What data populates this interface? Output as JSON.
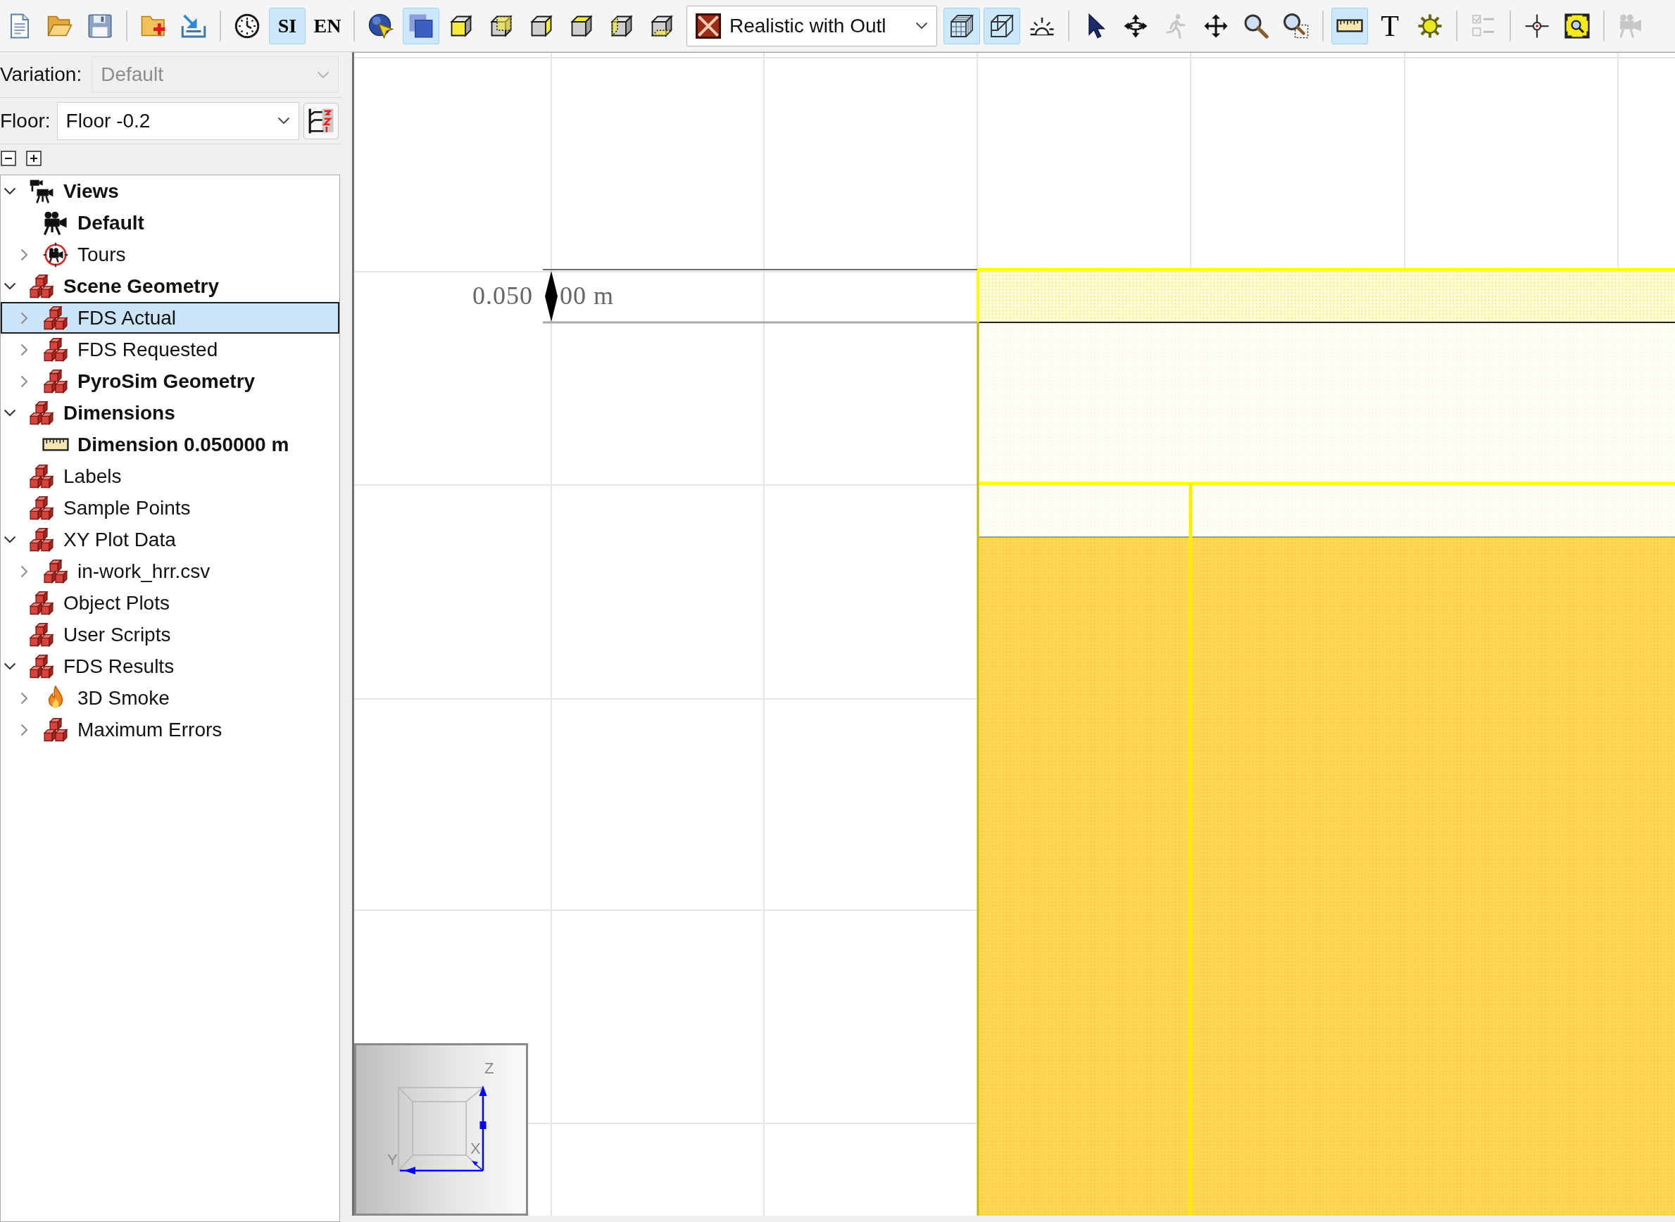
{
  "toolbar": {
    "items": [
      {
        "kind": "icon",
        "selected": false,
        "disabled": false
      },
      {
        "kind": "icon",
        "selected": false,
        "disabled": false
      },
      {
        "kind": "icon",
        "selected": false,
        "disabled": false
      },
      {
        "kind": "separator"
      },
      {
        "kind": "icon",
        "selected": false,
        "disabled": false
      },
      {
        "kind": "icon",
        "selected": false,
        "disabled": false
      },
      {
        "kind": "separator"
      },
      {
        "kind": "icon",
        "selected": false,
        "disabled": false
      },
      {
        "kind": "text",
        "label": "SI",
        "selected": true,
        "disabled": false
      },
      {
        "kind": "text",
        "label": "EN",
        "selected": false,
        "disabled": false
      },
      {
        "kind": "separator"
      },
      {
        "kind": "icon",
        "selected": false,
        "disabled": false
      },
      {
        "kind": "icon",
        "selected": true,
        "disabled": false
      },
      {
        "kind": "icon",
        "selected": false,
        "disabled": false
      },
      {
        "kind": "icon",
        "selected": false,
        "disabled": false
      },
      {
        "kind": "icon",
        "selected": false,
        "disabled": false
      },
      {
        "kind": "icon",
        "selected": false,
        "disabled": false
      },
      {
        "kind": "icon",
        "selected": false,
        "disabled": false
      },
      {
        "kind": "icon",
        "selected": false,
        "disabled": false
      },
      {
        "kind": "dropdown",
        "value": "Realistic with Outl"
      },
      {
        "kind": "icon",
        "selected": true,
        "disabled": false
      },
      {
        "kind": "icon",
        "selected": true,
        "disabled": false
      },
      {
        "kind": "icon",
        "selected": false,
        "disabled": false
      },
      {
        "kind": "separator"
      },
      {
        "kind": "icon",
        "selected": false,
        "disabled": false
      },
      {
        "kind": "icon",
        "selected": false,
        "disabled": false
      },
      {
        "kind": "icon",
        "selected": false,
        "disabled": true
      },
      {
        "kind": "icon",
        "selected": false,
        "disabled": false
      },
      {
        "kind": "icon",
        "selected": false,
        "disabled": false
      },
      {
        "kind": "icon",
        "selected": false,
        "disabled": false
      },
      {
        "kind": "separator"
      },
      {
        "kind": "icon",
        "selected": true,
        "disabled": false
      },
      {
        "kind": "text",
        "label": "T",
        "selected": false,
        "disabled": false
      },
      {
        "kind": "icon",
        "selected": false,
        "disabled": false
      },
      {
        "kind": "separator"
      },
      {
        "kind": "icon",
        "selected": false,
        "disabled": true
      },
      {
        "kind": "separator"
      },
      {
        "kind": "icon",
        "selected": false,
        "disabled": false
      },
      {
        "kind": "icon",
        "selected": false,
        "disabled": false
      },
      {
        "kind": "separator"
      },
      {
        "kind": "icon",
        "selected": false,
        "disabled": true
      }
    ]
  },
  "sidebar": {
    "variation": {
      "label": "Variation:",
      "value": "Default",
      "disabled": true
    },
    "floor": {
      "label": "Floor:",
      "value": "Floor -0.2"
    },
    "tree": [
      {
        "label": "Views",
        "kind": "views",
        "bold": true,
        "selected": false,
        "expanded": true,
        "children": [
          {
            "label": "Default",
            "kind": "camera",
            "bold": true,
            "selected": false
          },
          {
            "label": "Tours",
            "kind": "tour",
            "bold": false,
            "selected": false,
            "expanded": false
          }
        ]
      },
      {
        "label": "Scene Geometry",
        "kind": "group",
        "bold": true,
        "selected": false,
        "expanded": true,
        "children": [
          {
            "label": "FDS Actual",
            "kind": "group",
            "bold": false,
            "selected": true,
            "expanded": false
          },
          {
            "label": "FDS Requested",
            "kind": "group",
            "bold": false,
            "selected": false,
            "expanded": false
          },
          {
            "label": "PyroSim Geometry",
            "kind": "group",
            "bold": true,
            "selected": false,
            "expanded": false
          }
        ]
      },
      {
        "label": "Dimensions",
        "kind": "group",
        "bold": true,
        "selected": false,
        "expanded": true,
        "children": [
          {
            "label": "Dimension 0.050000 m",
            "kind": "dimension",
            "bold": true,
            "selected": false
          }
        ]
      },
      {
        "label": "Labels",
        "kind": "group",
        "bold": false,
        "selected": false
      },
      {
        "label": "Sample Points",
        "kind": "group",
        "bold": false,
        "selected": false
      },
      {
        "label": "XY Plot Data",
        "kind": "group",
        "bold": false,
        "selected": false,
        "expanded": true,
        "children": [
          {
            "label": "in-work_hrr.csv",
            "kind": "group",
            "bold": false,
            "selected": false,
            "expanded": false
          }
        ]
      },
      {
        "label": "Object Plots",
        "kind": "group",
        "bold": false,
        "selected": false
      },
      {
        "label": "User Scripts",
        "kind": "group",
        "bold": false,
        "selected": false
      },
      {
        "label": "FDS Results",
        "kind": "group",
        "bold": false,
        "selected": false,
        "expanded": true,
        "children": [
          {
            "label": "3D Smoke",
            "kind": "smoke",
            "bold": false,
            "selected": false,
            "expanded": false
          },
          {
            "label": "Maximum Errors",
            "kind": "group",
            "bold": false,
            "selected": false,
            "expanded": false
          }
        ]
      }
    ]
  },
  "viewport": {
    "dimension_label": {
      "before_arrow": "0.050",
      "after_arrow": "00 m"
    },
    "axis_labels": [
      "Z",
      "X",
      "Y"
    ]
  }
}
